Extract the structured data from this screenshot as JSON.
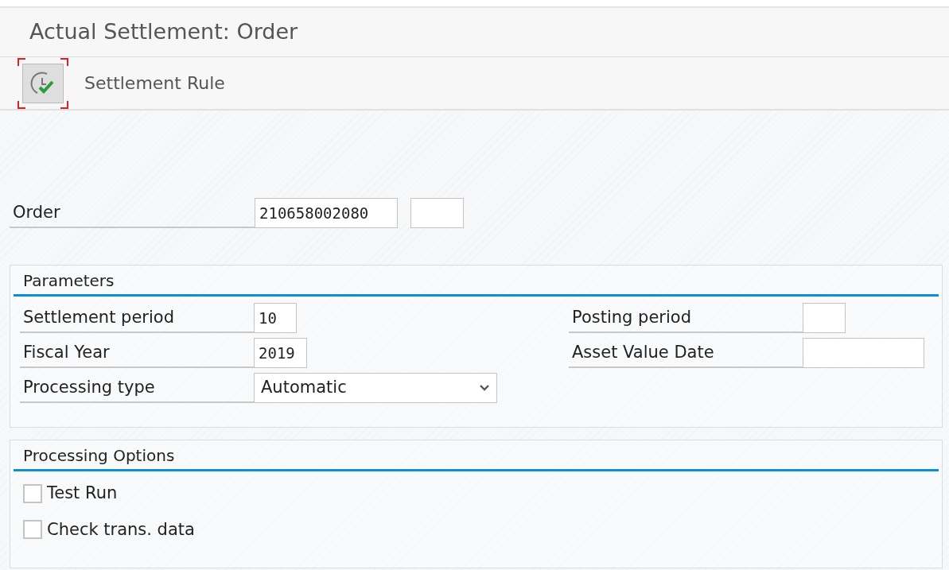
{
  "window": {
    "title": "Actual Settlement: Order"
  },
  "toolbar": {
    "buttons": [
      {
        "label": "Settlement Rule",
        "focused": true
      }
    ]
  },
  "order": {
    "label": "Order",
    "value": "210658002080",
    "fields": [
      {
        "kind": "short"
      }
    ]
  },
  "parameters": {
    "title": "Parameters",
    "left": [
      {
        "label": "Settlement period",
        "kind": "period",
        "value": "10"
      },
      {
        "label": "Fiscal Year",
        "kind": "year",
        "value": "2019"
      },
      {
        "label": "Processing type",
        "kind": "select",
        "value": "Automatic"
      }
    ],
    "right": [
      {
        "label": "Posting period",
        "kind": "period"
      },
      {
        "label": "Asset Value Date",
        "kind": "date"
      }
    ]
  },
  "processing_options": {
    "title": "Processing Options",
    "checkboxes": [
      {
        "label": "Test Run",
        "checked": false
      },
      {
        "label": "Check trans. data",
        "checked": false
      }
    ]
  }
}
